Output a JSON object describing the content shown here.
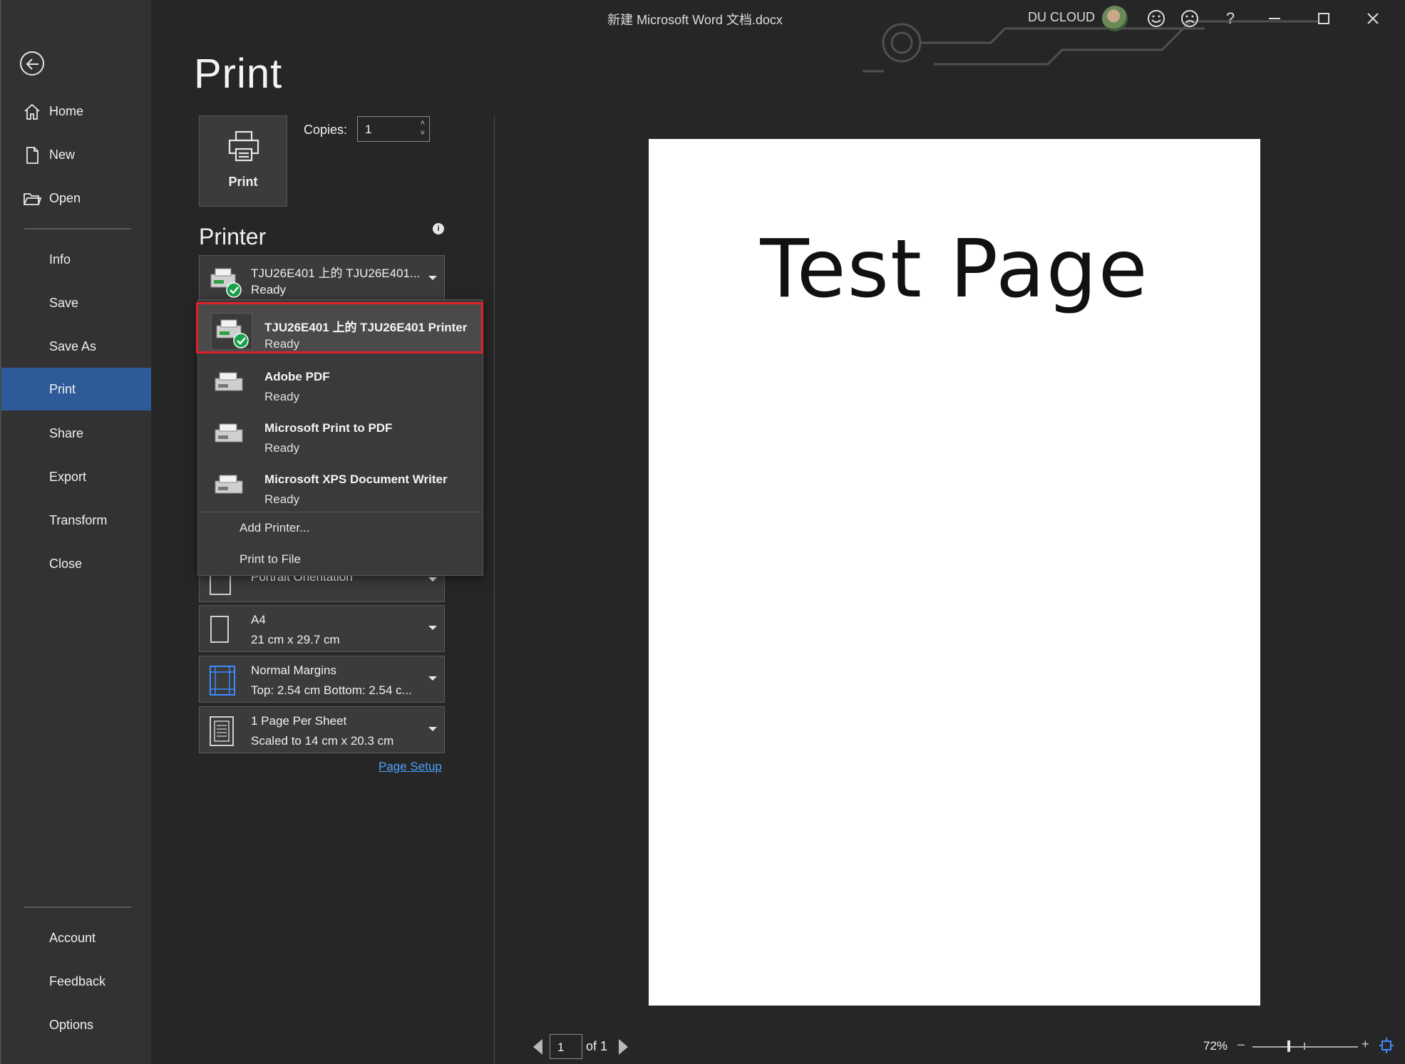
{
  "window": {
    "title": "新建 Microsoft Word 文档.docx",
    "account_name": "DU CLOUD",
    "help": "?"
  },
  "rail": {
    "top_items": [
      {
        "label": "Home",
        "icon": "home-icon"
      },
      {
        "label": "New",
        "icon": "new-document-icon"
      },
      {
        "label": "Open",
        "icon": "open-folder-icon"
      }
    ],
    "items": [
      "Info",
      "Save",
      "Save As",
      "Print",
      "Share",
      "Export",
      "Transform",
      "Close"
    ],
    "active": "Print",
    "bottom_items": [
      "Account",
      "Feedback",
      "Options"
    ]
  },
  "print": {
    "heading": "Print",
    "print_button": "Print",
    "copies_label": "Copies:",
    "copies_value": "1",
    "printer_section": "Printer",
    "selected_printer": {
      "name": "TJU26E401 上的 TJU26E401...",
      "status": "Ready"
    },
    "printers": [
      {
        "name": "TJU26E401 上的 TJU26E401 Printer",
        "status": "Ready"
      },
      {
        "name": "Adobe PDF",
        "status": "Ready"
      },
      {
        "name": "Microsoft Print to PDF",
        "status": "Ready"
      },
      {
        "name": "Microsoft XPS Document Writer",
        "status": "Ready"
      }
    ],
    "add_printer": "Add Printer...",
    "print_to_file": "Print to File",
    "settings": {
      "orientation": {
        "line1": "Portrait Orientation"
      },
      "paper": {
        "line1": "A4",
        "line2": "21 cm x 29.7 cm"
      },
      "margins": {
        "line1": "Normal Margins",
        "line2": "Top: 2.54 cm Bottom: 2.54 c..."
      },
      "pages_per_sheet": {
        "line1": "1 Page Per Sheet",
        "line2": "Scaled to 14 cm x 20.3 cm"
      }
    },
    "page_setup_link": "Page Setup"
  },
  "preview": {
    "page_text": "Test Page",
    "current_page": "1",
    "of_pages": "of 1",
    "zoom": "72%",
    "zoom_level": 0.72
  },
  "colors": {
    "accent": "#2e5a99",
    "highlight": "#e0212b",
    "link": "#4da3ff",
    "ready_check": "#17a34a"
  }
}
